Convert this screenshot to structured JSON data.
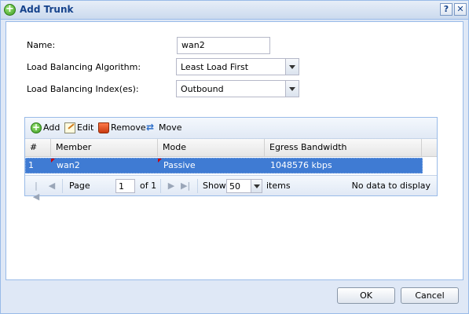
{
  "window": {
    "title": "Add Trunk",
    "help_label": "?",
    "close_label": "✕",
    "icon": "add-circle-icon"
  },
  "form": {
    "name_label": "Name:",
    "name_value": "wan2",
    "algorithm_label": "Load Balancing Algorithm:",
    "algorithm_value": "Least Load First",
    "index_label": "Load Balancing Index(es):",
    "index_value": "Outbound"
  },
  "toolbar": {
    "add_label": "Add",
    "edit_label": "Edit",
    "remove_label": "Remove",
    "move_label": "Move"
  },
  "table": {
    "columns": [
      "#",
      "Member",
      "Mode",
      "Egress Bandwidth"
    ],
    "rows": [
      {
        "index": "1",
        "member": "wan2",
        "mode": "Passive",
        "bandwidth": "1048576 kbps"
      }
    ]
  },
  "pager": {
    "page_label": "Page",
    "page_value": "1",
    "of_label": "of 1",
    "show_label": "Show",
    "show_value": "50",
    "items_label": "items",
    "status": "No data to display"
  },
  "buttons": {
    "ok": "OK",
    "cancel": "Cancel"
  },
  "colors": {
    "selected_row": "#3f7bd3",
    "title_text": "#15428b",
    "border": "#99bbe8"
  }
}
